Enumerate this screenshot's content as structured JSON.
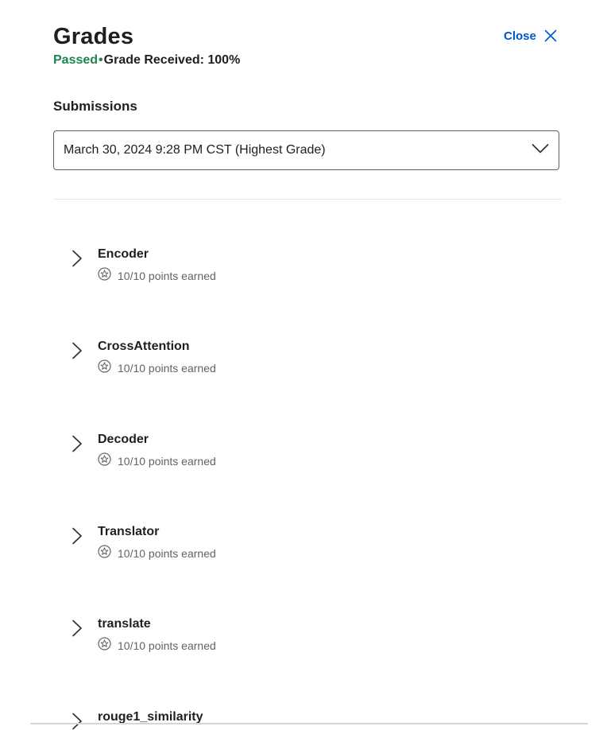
{
  "header": {
    "title": "Grades",
    "close_label": "Close",
    "status": "Passed",
    "separator": "•",
    "grade_received": "Grade Received: 100%"
  },
  "submissions": {
    "label": "Submissions",
    "selected": "March 30, 2024 9:28 PM CST (Highest Grade)"
  },
  "items": [
    {
      "name": "Encoder",
      "points": "10/10 points earned"
    },
    {
      "name": "CrossAttention",
      "points": "10/10 points earned"
    },
    {
      "name": "Decoder",
      "points": "10/10 points earned"
    },
    {
      "name": "Translator",
      "points": "10/10 points earned"
    },
    {
      "name": "translate",
      "points": "10/10 points earned"
    },
    {
      "name": "rouge1_similarity",
      "points": ""
    }
  ],
  "colors": {
    "accent": "#0056d2",
    "passed": "#1f8354",
    "muted_text": "#636363"
  }
}
